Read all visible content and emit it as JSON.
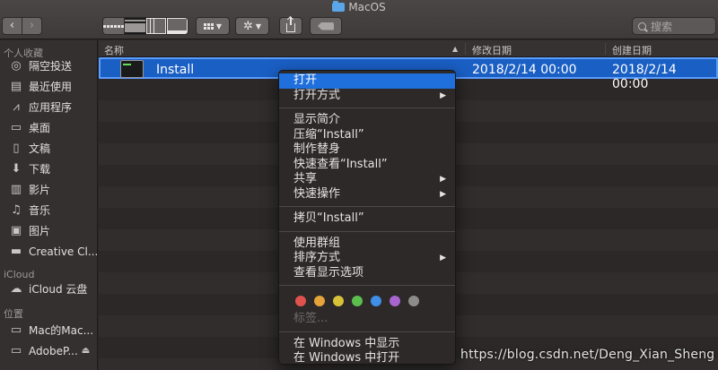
{
  "window": {
    "title": "MacOS"
  },
  "toolbar": {
    "back_icon": "chevron-left-icon",
    "forward_icon": "chevron-right-icon",
    "views": [
      "icon-view",
      "list-view",
      "column-view",
      "gallery-view"
    ],
    "active_view": "list-view",
    "search_placeholder": "搜索"
  },
  "sidebar": {
    "sections": [
      {
        "header": "个人收藏",
        "items": [
          {
            "label": "隔空投送",
            "icon": "airdrop-icon"
          },
          {
            "label": "最近使用",
            "icon": "recents-icon"
          },
          {
            "label": "应用程序",
            "icon": "applications-icon"
          },
          {
            "label": "桌面",
            "icon": "desktop-icon"
          },
          {
            "label": "文稿",
            "icon": "documents-icon"
          },
          {
            "label": "下载",
            "icon": "downloads-icon"
          },
          {
            "label": "影片",
            "icon": "movies-icon"
          },
          {
            "label": "音乐",
            "icon": "music-icon"
          },
          {
            "label": "图片",
            "icon": "pictures-icon"
          },
          {
            "label": "Creative Cl...",
            "icon": "folder-icon"
          }
        ]
      },
      {
        "header": "iCloud",
        "items": [
          {
            "label": "iCloud 云盘",
            "icon": "cloud-icon"
          }
        ]
      },
      {
        "header": "位置",
        "items": [
          {
            "label": "Mac的Mac...",
            "icon": "laptop-icon"
          },
          {
            "label": "AdobeP...",
            "icon": "disk-icon",
            "eject": "⏏"
          }
        ]
      }
    ]
  },
  "columns": {
    "name": "名称",
    "modified": "修改日期",
    "created": "创建日期"
  },
  "files": [
    {
      "name": "Install",
      "modified": "2018/2/14 00:00",
      "created": "2018/2/14 00:00",
      "icon": "terminal-icon",
      "selected": true
    }
  ],
  "context_menu": {
    "groups": [
      [
        {
          "label": "打开",
          "highlighted": true
        },
        {
          "label": "打开方式",
          "submenu": true
        }
      ],
      [
        {
          "label": "显示简介"
        },
        {
          "label": "压缩“Install”"
        },
        {
          "label": "制作替身"
        },
        {
          "label": "快速查看“Install”"
        },
        {
          "label": "共享",
          "submenu": true
        },
        {
          "label": "快速操作",
          "submenu": true
        }
      ],
      [
        {
          "label": "拷贝“Install”"
        }
      ],
      [
        {
          "label": "使用群组"
        },
        {
          "label": "排序方式",
          "submenu": true
        },
        {
          "label": "查看显示选项"
        }
      ]
    ],
    "tag_colors": [
      "#e0524d",
      "#e5a33a",
      "#d8c23a",
      "#5bbf4e",
      "#3f8ee8",
      "#a865cf",
      "#8e8c8a"
    ],
    "tags_label": "标签...",
    "windows_items": [
      {
        "label": "在 Windows 中显示"
      },
      {
        "label": "在 Windows 中打开"
      }
    ]
  },
  "watermark": "https://blog.csdn.net/Deng_Xian_Sheng"
}
